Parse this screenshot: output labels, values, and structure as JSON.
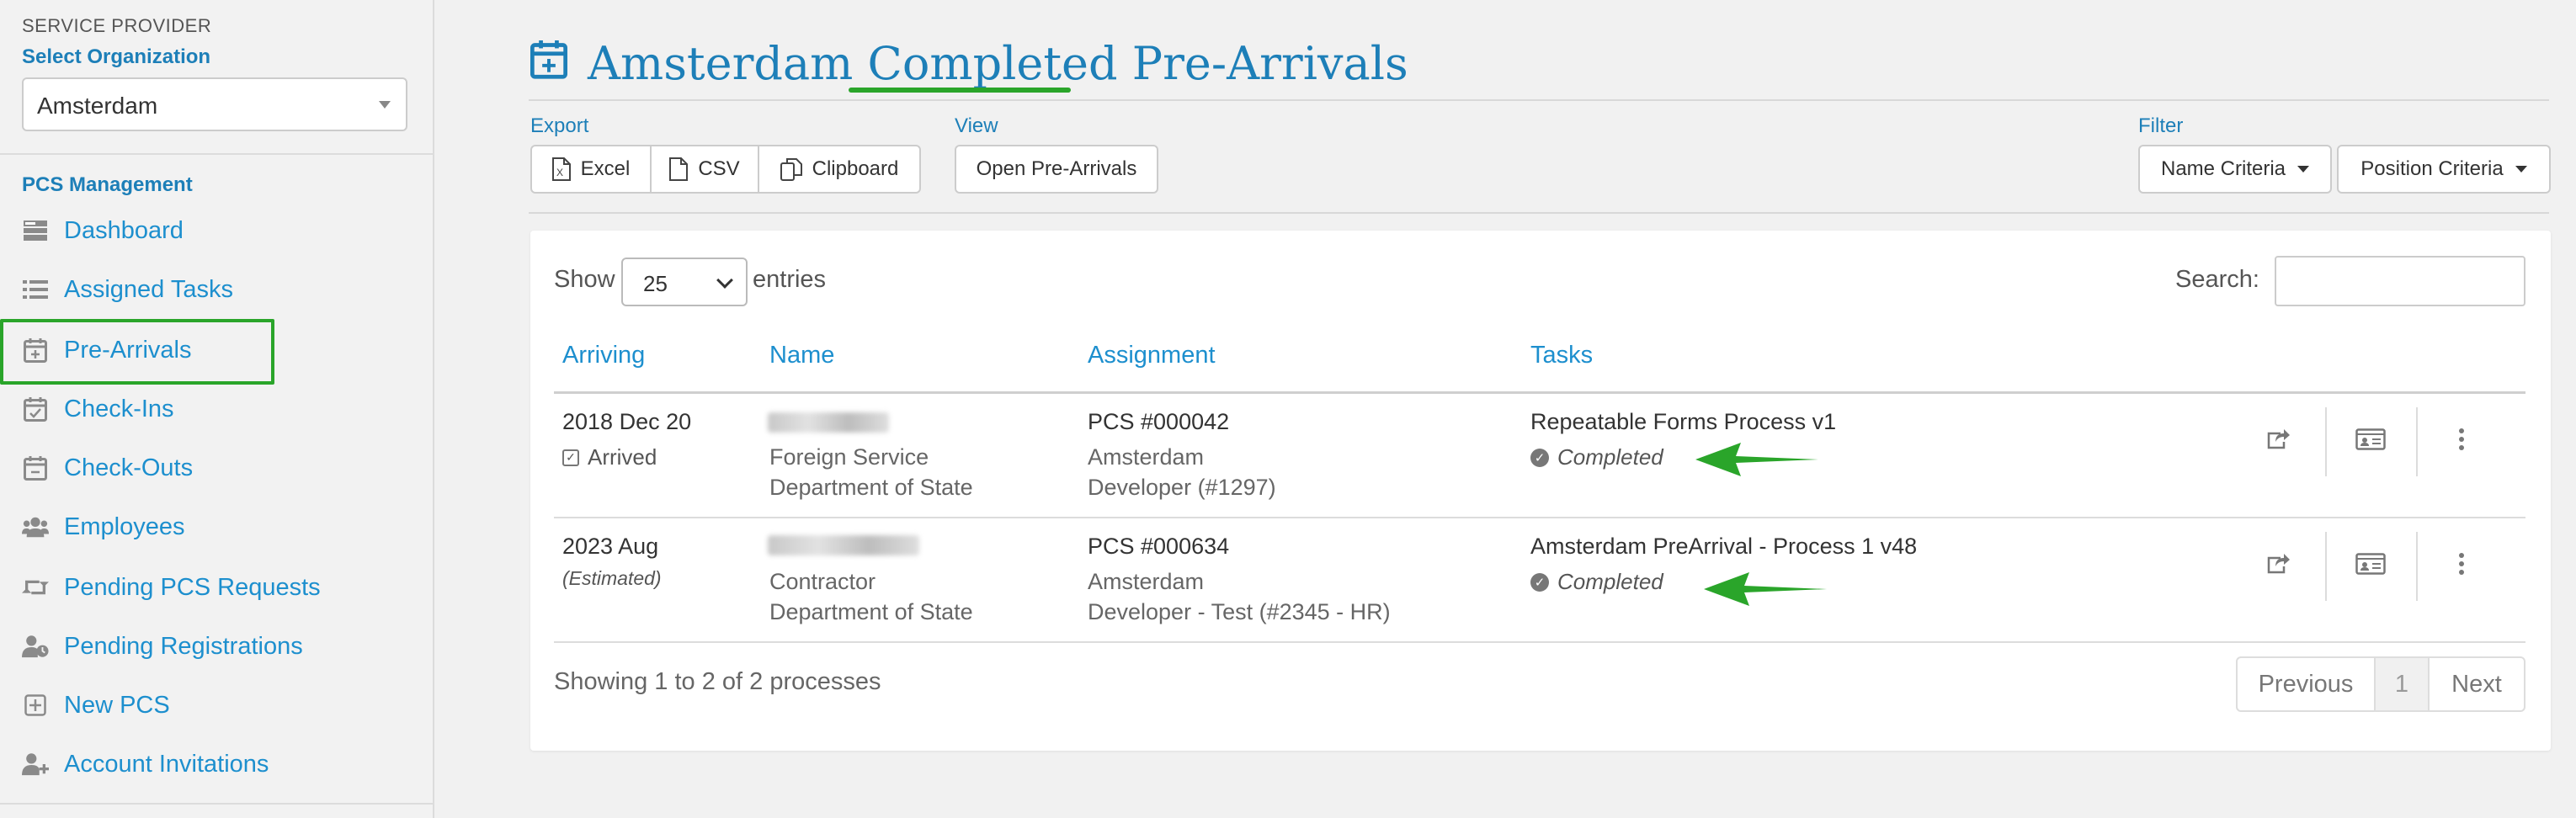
{
  "sidebar": {
    "service_provider_label": "SERVICE PROVIDER",
    "select_org_label": "Select Organization",
    "org_value": "Amsterdam",
    "section_title": "PCS Management",
    "items": [
      {
        "label": "Dashboard",
        "icon": "dashboard-icon"
      },
      {
        "label": "Assigned Tasks",
        "icon": "list-icon"
      },
      {
        "label": "Pre-Arrivals",
        "icon": "calendar-plus-icon",
        "active": true
      },
      {
        "label": "Check-Ins",
        "icon": "calendar-check-icon"
      },
      {
        "label": "Check-Outs",
        "icon": "calendar-minus-icon"
      },
      {
        "label": "Employees",
        "icon": "users-icon"
      },
      {
        "label": "Pending PCS Requests",
        "icon": "retweet-icon"
      },
      {
        "label": "Pending Registrations",
        "icon": "user-clock-icon"
      },
      {
        "label": "New PCS",
        "icon": "plus-square-icon"
      },
      {
        "label": "Account Invitations",
        "icon": "user-plus-icon"
      }
    ]
  },
  "header": {
    "title_prefix": "Amsterdam",
    "title_highlight": "Completed",
    "title_suffix": "Pre-Arrivals"
  },
  "toolbar": {
    "export_label": "Export",
    "excel_label": "Excel",
    "csv_label": "CSV",
    "clipboard_label": "Clipboard",
    "view_label": "View",
    "open_prearrivals_label": "Open Pre-Arrivals",
    "filter_label": "Filter",
    "name_criteria_label": "Name Criteria",
    "position_criteria_label": "Position Criteria"
  },
  "table": {
    "show_label": "Show",
    "entries_value": "25",
    "entries_label": "entries",
    "search_label": "Search:",
    "columns": [
      "Arriving",
      "Name",
      "Assignment",
      "Tasks"
    ],
    "rows": [
      {
        "arriving": "2018 Dec 20",
        "arriving_status": "Arrived",
        "name_line2": "Foreign Service",
        "name_line3": "Department of State",
        "pcs": "PCS #000042",
        "location": "Amsterdam",
        "position": "Developer (#1297)",
        "task": "Repeatable Forms Process v1",
        "task_status": "Completed"
      },
      {
        "arriving": "2023 Aug",
        "arriving_status": "(Estimated)",
        "name_line2": "Contractor",
        "name_line3": "Department of State",
        "pcs": "PCS #000634",
        "location": "Amsterdam",
        "position": "Developer - Test (#2345 - HR)",
        "task": "Amsterdam PreArrival - Process 1 v48",
        "task_status": "Completed"
      }
    ],
    "info": "Showing 1 to 2 of 2 processes",
    "pagination": {
      "previous": "Previous",
      "current": "1",
      "next": "Next"
    }
  },
  "colors": {
    "accent": "#1d7fb8",
    "link": "#1d8fce",
    "highlight_green": "#2aa52a"
  }
}
